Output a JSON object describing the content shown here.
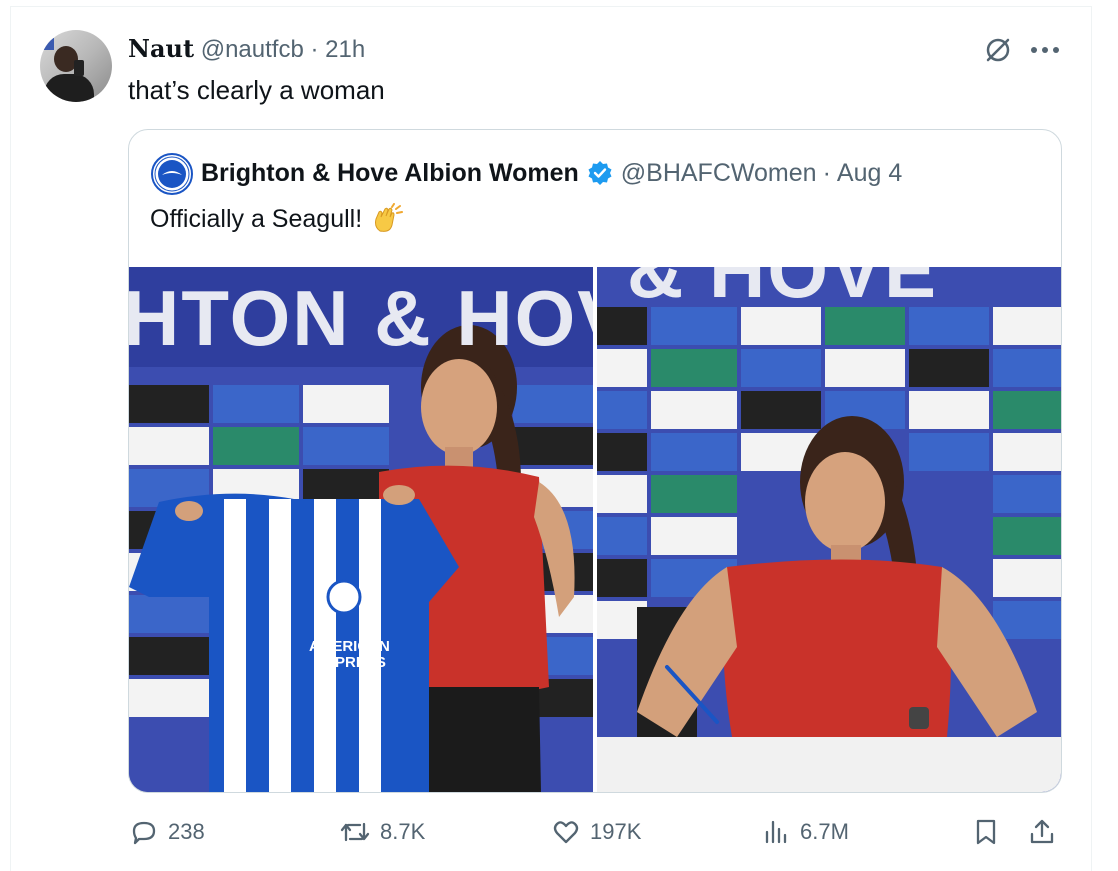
{
  "tweet": {
    "author_name": "Naut",
    "handle": "@nautfcb",
    "separator": "·",
    "time": "21h",
    "text": "that’s clearly a woman"
  },
  "quoted_tweet": {
    "author_name": "Brighton & Hove Albion Women",
    "handle": "@BHAFCWomen",
    "separator": "·",
    "date": "Aug 4",
    "text": "Officially a Seagull!",
    "emoji": "clapping-hands-icon",
    "photo_left_wall_text": "HTON & HOV",
    "photo_right_wall_text": "& HOVE"
  },
  "actions": {
    "replies": "238",
    "retweets": "8.7K",
    "likes": "197K",
    "views": "6.7M"
  },
  "colors": {
    "text_primary": "#0f1419",
    "text_secondary": "#536471",
    "border": "#cfd9de",
    "verified_blue": "#1d9bf0",
    "brand_blue": "#1a55c4"
  }
}
